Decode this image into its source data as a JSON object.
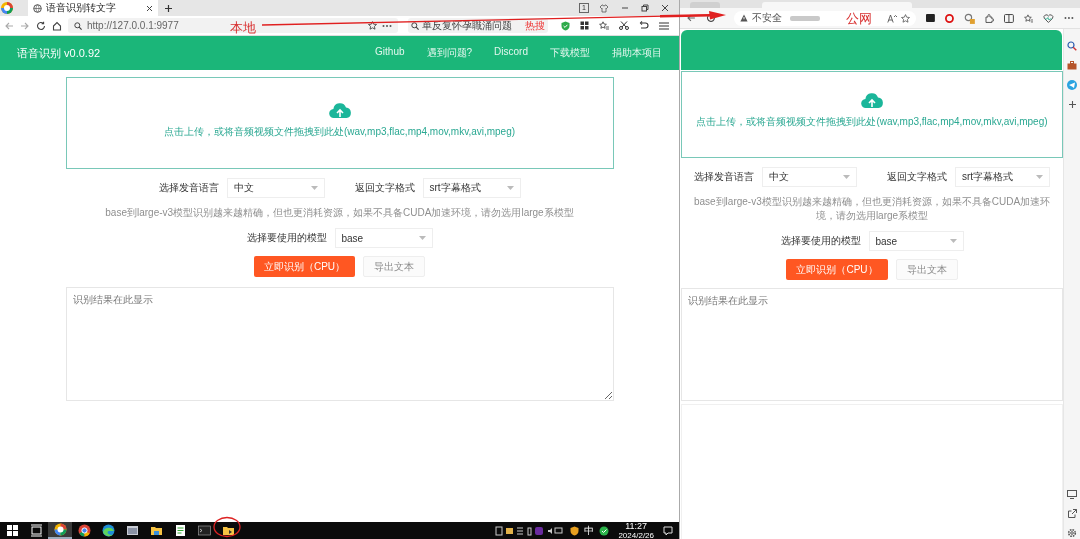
{
  "annotations": [
    {
      "text": "本地"
    },
    {
      "text": "公网"
    }
  ],
  "local_browser": {
    "tab": {
      "title": "语音识别转文字",
      "selected": true
    },
    "tab_count": "1",
    "url": "http://127.0.0.1:9977",
    "search": {
      "value": "单反复怀孕職涌问题",
      "hot_label": "热搜"
    }
  },
  "local_app": {
    "title": "语音识别 v0.0.92",
    "nav": [
      "Github",
      "遇到问题?",
      "Discord",
      "下载模型",
      "捐助本项目"
    ],
    "upload_hint": "点击上传，或将音频视频文件拖拽到此处(wav,mp3,flac,mp4,mov,mkv,avi,mpeg)",
    "language": {
      "label": "选择发音语言",
      "value": "中文"
    },
    "format": {
      "label": "返回文字格式",
      "value": "srt字幕格式"
    },
    "model_hint": "base到large-v3模型识别越来越精确，但也更消耗资源，如果不具备CUDA加速环境，请勿选用large系模型",
    "model": {
      "label": "选择要使用的模型",
      "value": "base"
    },
    "buttons": [
      {
        "label": "立即识别（CPU）",
        "disabled": false
      },
      {
        "label": "导出文本",
        "disabled": true
      }
    ],
    "result": {
      "placeholder": "识别结果在此显示"
    }
  },
  "taskbar": {
    "items": [
      {
        "kind": "start",
        "active": false,
        "circled": false
      },
      {
        "kind": "taskview",
        "active": false,
        "circled": false
      },
      {
        "kind": "browser360",
        "active": true,
        "circled": false
      },
      {
        "kind": "chrome",
        "active": false,
        "circled": false
      },
      {
        "kind": "edge",
        "active": false,
        "circled": false
      },
      {
        "kind": "app",
        "active": false,
        "circled": false
      },
      {
        "kind": "folder",
        "active": false,
        "circled": false
      },
      {
        "kind": "notepad",
        "active": false,
        "circled": false
      },
      {
        "kind": "terminal",
        "active": false,
        "circled": false
      },
      {
        "kind": "appfolder",
        "active": false,
        "circled": true
      }
    ],
    "ime": "中",
    "time": "11:27",
    "date": "2024/2/26"
  },
  "remote_browser": {
    "security_label": "不安全"
  },
  "remote_app": {
    "upload_hint": "点击上传，或将音频视频文件拖拽到此处(wav,mp3,flac,mp4,mov,mkv,avi,mpeg)",
    "language": {
      "label": "选择发音语言",
      "value": "中文"
    },
    "format": {
      "label": "返回文字格式",
      "value": "srt字幕格式"
    },
    "model_hint": "base到large-v3模型识别越来越精确，但也更消耗资源，如果不具备CUDA加速环境，请勿选用large系模型",
    "model": {
      "label": "选择要使用的模型",
      "value": "base"
    },
    "buttons": [
      {
        "label": "立即识别（CPU）",
        "disabled": false
      },
      {
        "label": "导出文本",
        "disabled": true
      }
    ],
    "result": {
      "placeholder": "识别结果在此显示"
    }
  }
}
